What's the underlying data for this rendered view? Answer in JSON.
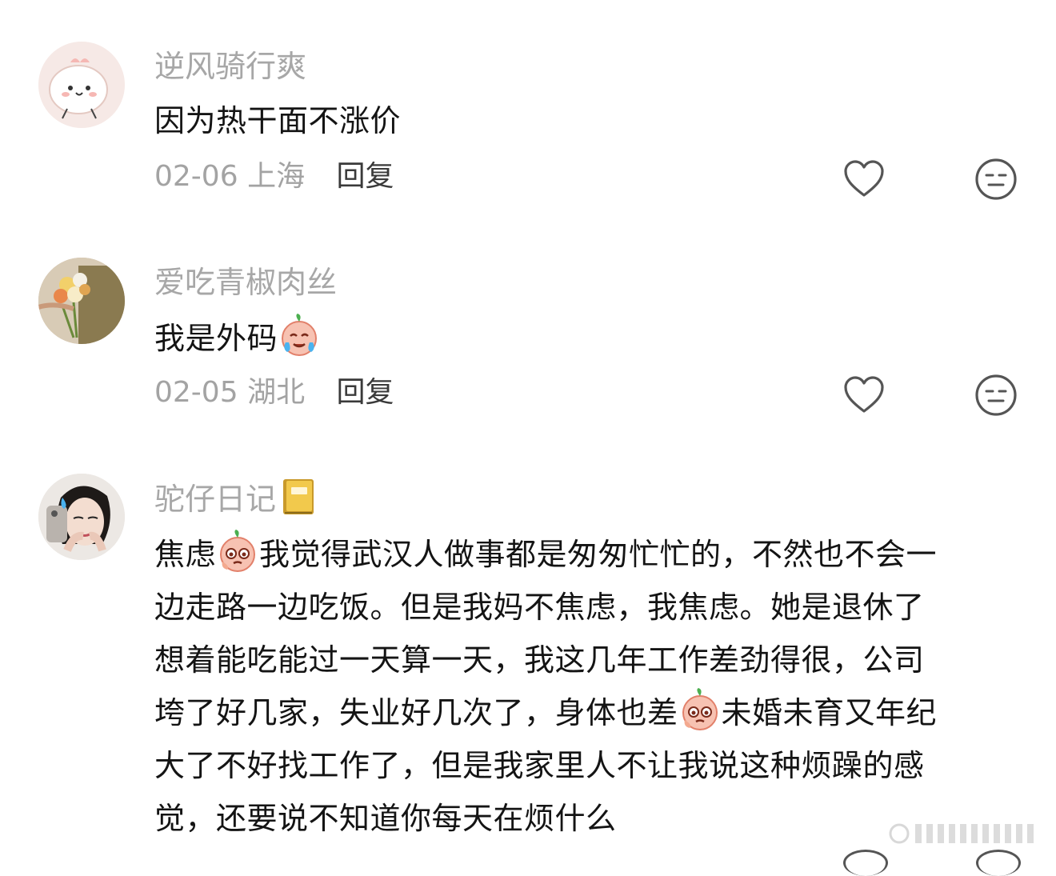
{
  "comments": [
    {
      "username": "逆风骑行爽",
      "text": "因为热干面不涨价",
      "date": "02-06",
      "location": "上海",
      "reply_label": "回复"
    },
    {
      "username": "爱吃青椒肉丝",
      "text": "我是外码",
      "date": "02-05",
      "location": "湖北",
      "reply_label": "回复"
    },
    {
      "username": "驼仔日记",
      "text_lines": [
        "焦虑",
        "我觉得武汉人做事都是匆匆忙忙的，不然也不会一",
        "边走路一边吃饭。但是我妈不焦虑，我焦虑。她是退休了",
        "想着能吃能过一天算一天，我这几年工作差劲得很，公司",
        "垮了好几家，失业好几次了，身体也差",
        "未婚未育又年纪",
        "大了不好找工作了，但是我家里人不让我说这种烦躁的感",
        "觉，还要说不知道你每天在烦什么"
      ]
    }
  ],
  "icons": {
    "like": "heart-icon",
    "dislike": "neutral-face-icon",
    "emoji": "crying-peach-emoji",
    "book": "notebook-icon"
  },
  "colors": {
    "username": "#a7a7a7",
    "meta": "#a3a3a3",
    "text": "#141414",
    "icon": "#555555"
  }
}
